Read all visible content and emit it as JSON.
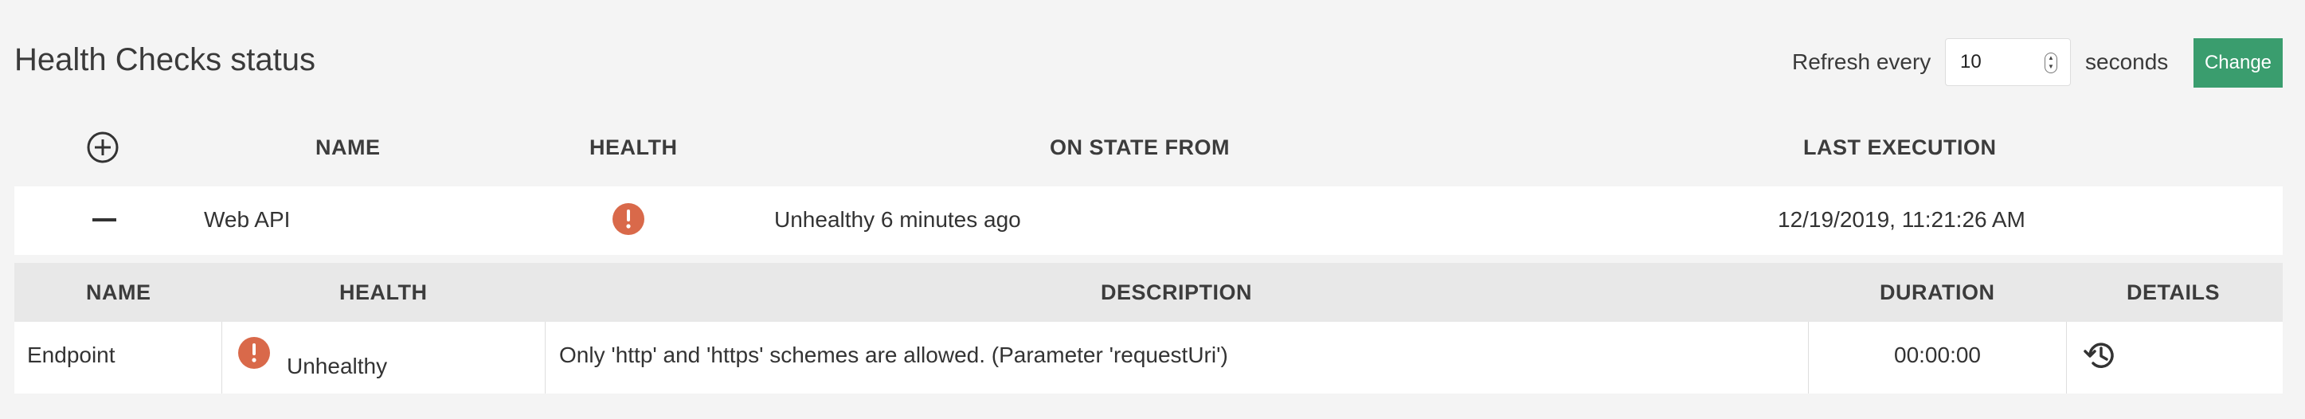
{
  "header": {
    "title": "Health Checks status",
    "refresh_label": "Refresh every",
    "refresh_value": "10",
    "seconds_label": "seconds",
    "change_label": "Change"
  },
  "main_table": {
    "columns": [
      "NAME",
      "HEALTH",
      "ON STATE FROM",
      "LAST EXECUTION"
    ],
    "rows": [
      {
        "name": "Web API",
        "health": "Unhealthy",
        "on_state_from": "Unhealthy 6 minutes ago",
        "last_execution": "12/19/2019, 11:21:26 AM"
      }
    ]
  },
  "detail_table": {
    "columns": [
      "NAME",
      "HEALTH",
      "DESCRIPTION",
      "DURATION",
      "DETAILS"
    ],
    "rows": [
      {
        "name": "Endpoint",
        "health": "Unhealthy",
        "description": "Only 'http' and 'https' schemes are allowed. (Parameter 'requestUri')",
        "duration": "00:00:00"
      }
    ]
  },
  "colors": {
    "accent": "#3a9d6e",
    "unhealthy": "#d9694a",
    "background": "#f4f4f4"
  },
  "icons": {
    "add": "plus-circle-icon",
    "collapse": "minus-icon",
    "status": "exclamation-circle-icon",
    "history": "history-icon"
  }
}
